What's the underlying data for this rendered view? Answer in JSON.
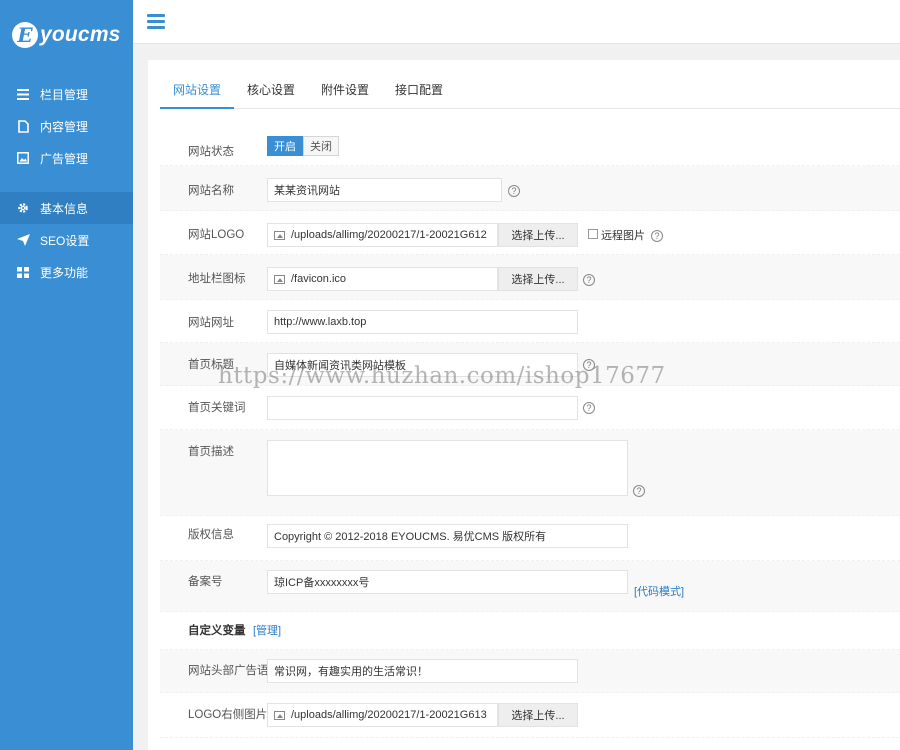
{
  "brand": {
    "logo_letter": "E",
    "logo_text": "youcms"
  },
  "sidebar": {
    "items": [
      {
        "label": "栏目管理",
        "icon": "list-icon"
      },
      {
        "label": "内容管理",
        "icon": "document-icon"
      },
      {
        "label": "广告管理",
        "icon": "image-icon"
      },
      {
        "label": "基本信息",
        "icon": "gear-icon"
      },
      {
        "label": "SEO设置",
        "icon": "send-icon"
      },
      {
        "label": "更多功能",
        "icon": "grid-icon"
      }
    ],
    "active_index": 3
  },
  "tabs": [
    {
      "label": "网站设置",
      "active": true
    },
    {
      "label": "核心设置",
      "active": false
    },
    {
      "label": "附件设置",
      "active": false
    },
    {
      "label": "接口配置",
      "active": false
    }
  ],
  "form": {
    "status": {
      "label": "网站状态",
      "on_label": "开启",
      "off_label": "关闭",
      "value": "开启"
    },
    "site_name": {
      "label": "网站名称",
      "value": "某某资讯网站"
    },
    "site_logo": {
      "label": "网站LOGO",
      "value": "/uploads/allimg/20200217/1-20021G612",
      "button": "选择上传...",
      "remote_label": "远程图片"
    },
    "favicon": {
      "label": "地址栏图标",
      "value": "/favicon.ico",
      "button": "选择上传..."
    },
    "site_url": {
      "label": "网站网址",
      "value": "http://www.laxb.top"
    },
    "home_title": {
      "label": "首页标题",
      "value": "自媒体新闻资讯类网站模板"
    },
    "home_keywords": {
      "label": "首页关键词",
      "value": ""
    },
    "home_description": {
      "label": "首页描述",
      "value": ""
    },
    "copyright": {
      "label": "版权信息",
      "value": "Copyright © 2012-2018 EYOUCMS. 易优CMS 版权所有"
    },
    "icp": {
      "label": "备案号",
      "value": "琼ICP备xxxxxxxx号",
      "code_mode_link": "[代码模式]"
    },
    "custom_vars": {
      "label": "自定义变量",
      "manage_link": "[管理]"
    },
    "header_ad": {
      "label": "网站头部广告语",
      "value": "常识网，有趣实用的生活常识！"
    },
    "logo_right_img": {
      "label": "LOGO右侧图片",
      "value": "/uploads/allimg/20200217/1-20021G613",
      "button": "选择上传..."
    }
  },
  "help_glyph": "?",
  "watermark": "https://www.huzhan.com/ishop17677",
  "colors": {
    "sidebar": "#3a8fd4",
    "accent": "#3a8fd4",
    "link": "#2a7ac7"
  }
}
